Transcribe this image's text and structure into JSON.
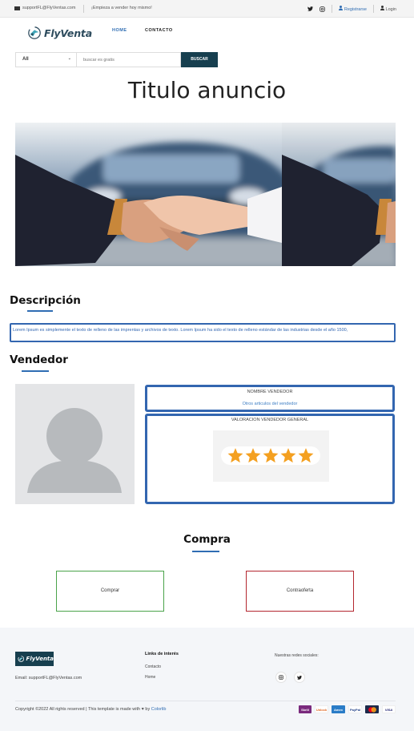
{
  "topbar": {
    "email": "supportFL@FlyVentas.com",
    "tagline": "¡Empieza a vender hoy mismo!",
    "register": "Registrarse",
    "login": "Login"
  },
  "header": {
    "logo_text": "FlyVenta",
    "nav": {
      "home": "HOME",
      "contact": "CONTACTO"
    }
  },
  "search": {
    "category_selected": "All",
    "placeholder": "buscar es gratis",
    "button": "BUSCAR"
  },
  "listing": {
    "title": "Titulo anuncio",
    "description_heading": "Descripción",
    "description": "Lorem Ipsum es simplemente el texto de relleno de las imprentas y archivos de texto. Lorem Ipsum ha sido el texto de relleno estándar de las industrias desde el año 1500,"
  },
  "seller": {
    "heading": "Vendedor",
    "name": "NOMBRE VENDEDOR",
    "other_items_link": "Otros articulos del vendedor",
    "rating_label": "VALORACION VENDEDOR GENERAL",
    "rating": 5,
    "rating_max": 5,
    "star_color": "#f4a020"
  },
  "purchase": {
    "heading": "Compra",
    "buy": "Comprar",
    "counter_offer": "Contraoferta",
    "buy_color": "#4aa34a",
    "offer_color": "#b3262f"
  },
  "footer": {
    "logo_text": "FlyVenta",
    "email_line": "Email: supportFL@FlyVentas.com",
    "links_heading": "Links de interés",
    "links": [
      "Contacto",
      "Home"
    ],
    "social_heading": "Nuestras redes sociales:",
    "copyright_pre": "Copyright ©2022 All rights reserved | This template is made with",
    "copyright_by": "by",
    "copyright_link": "Colorlib",
    "payments": [
      "Skrill",
      "Unlock",
      "Amex",
      "PayPal",
      "MasterCard",
      "VISA"
    ]
  },
  "colors": {
    "accent": "#2f6db3",
    "dark": "#173f4f",
    "box_border": "#3366b0"
  }
}
